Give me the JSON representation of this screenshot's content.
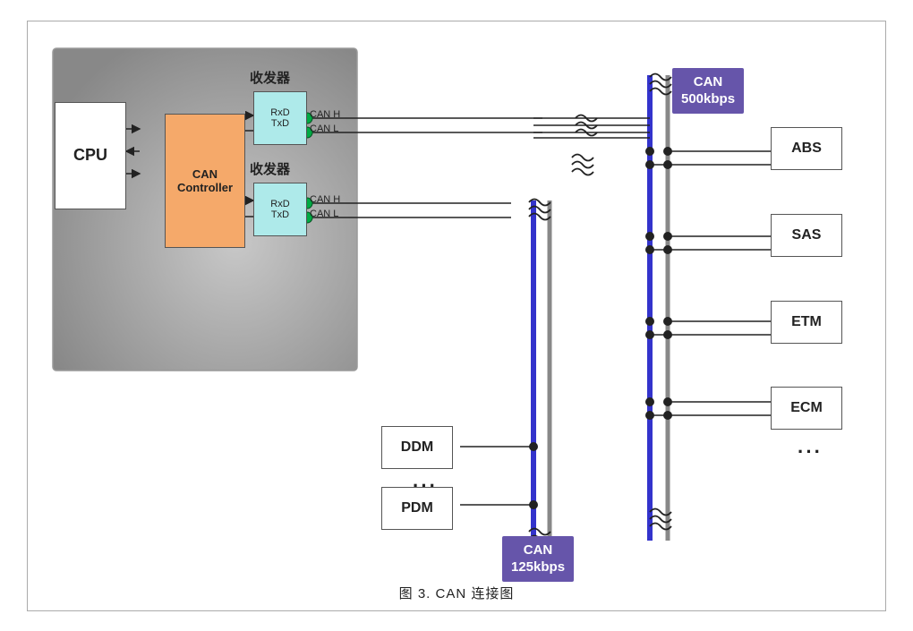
{
  "diagram": {
    "title": "图 3.   CAN 连接图",
    "left_box": {
      "label": ""
    },
    "cpu": {
      "label": "CPU"
    },
    "can_controller": {
      "line1": "CAN",
      "line2": "Controller"
    },
    "transceiver_top": {
      "title": "收发器",
      "line1": "RxD",
      "line2": "TxD",
      "canh": "CAN H",
      "canl": "CAN L"
    },
    "transceiver_bottom": {
      "title": "收发器",
      "line1": "RxD",
      "line2": "TxD",
      "canh": "CAN H",
      "canl": "CAN L"
    },
    "can_badge_top": {
      "line1": "CAN",
      "line2": "500kbps"
    },
    "can_badge_bottom": {
      "line1": "CAN",
      "line2": "125kbps"
    },
    "nodes_right": [
      "ABS",
      "SAS",
      "ETM",
      "ECM"
    ],
    "nodes_right_dots": "···",
    "nodes_bottom": [
      "DDM",
      "PDM"
    ],
    "nodes_bottom_dots": "···",
    "colors": {
      "blue_bus": "#3333cc",
      "gray_bus": "#888888",
      "can_badge_bg": "#6655aa",
      "transceiver_bg": "#aeeaea",
      "can_ctrl_bg": "#f5a96a",
      "left_box_bg": "#aaaaaa",
      "wire": "#222222",
      "green_dot": "#00aa44"
    }
  }
}
